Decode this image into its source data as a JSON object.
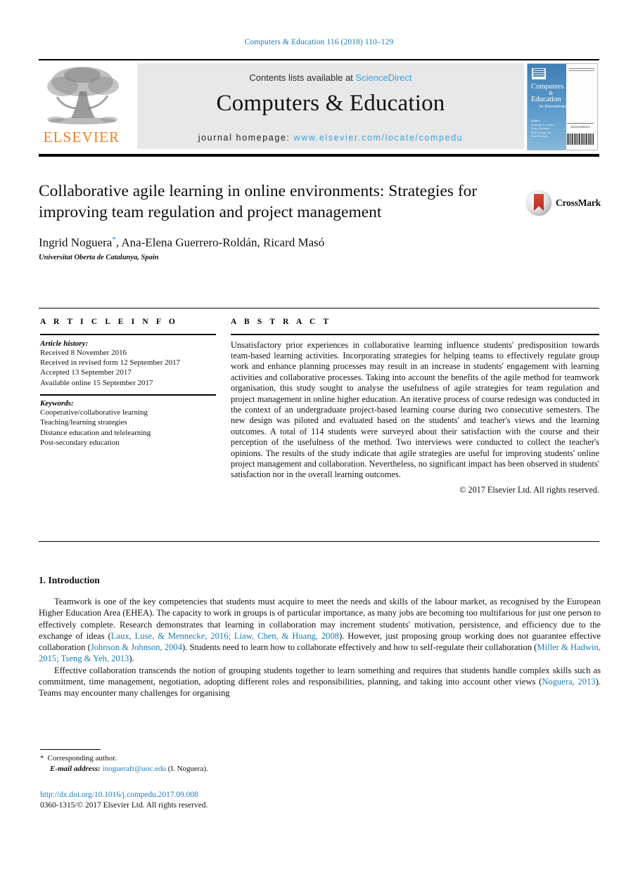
{
  "running_head": "Computers & Education 116 (2018) 110–129",
  "masthead": {
    "contents_prefix": "Contents lists available at ",
    "contents_link": "ScienceDirect",
    "journal_title": "Computers & Education",
    "homepage_prefix": "journal homepage: ",
    "homepage_url": "www.elsevier.com/locate/compedu",
    "publisher_name": "ELSEVIER",
    "publisher_logo": "elsevier-tree-logo"
  },
  "cover": {
    "title_line1": "Computers",
    "amp": "&",
    "title_line2": "Education",
    "subtitle": "An International Journal",
    "editors_label": "Editors",
    "editors": [
      "Rachelle S. Heller",
      "Peter Reimann",
      "Mike Chung Tai",
      "Kent Norman"
    ],
    "publisher_mark": "ScienceDirect",
    "barcode": "barcode"
  },
  "article": {
    "title": "Collaborative agile learning in online environments: Strategies for improving team regulation and project management",
    "authors": "Ingrid Noguera",
    "author_marker": "*",
    "authors_rest": ", Ana-Elena Guerrero-Roldán, Ricard Masó",
    "affiliation": "Universitat Oberta de Catalunya, Spain",
    "crossmark_label": "CrossMark"
  },
  "info": {
    "heading": "A R T I C L E   I N F O",
    "history_label": "Article history:",
    "history": [
      "Received 8 November 2016",
      "Received in revised form 12 September 2017",
      "Accepted 13 September 2017",
      "Available online 15 September 2017"
    ],
    "keywords_label": "Keywords:",
    "keywords": [
      "Cooperative/collaborative learning",
      "Teaching/learning strategies",
      "Distance education and telelearning",
      "Post-secondary education"
    ]
  },
  "abstract": {
    "heading": "A B S T R A C T",
    "text": "Unsatisfactory prior experiences in collaborative learning influence students' predisposition towards team-based learning activities. Incorporating strategies for helping teams to effectively regulate group work and enhance planning processes may result in an increase in students' engagement with learning activities and collaborative processes. Taking into account the benefits of the agile method for teamwork organisation, this study sought to analyse the usefulness of agile strategies for team regulation and project management in online higher education. An iterative process of course redesign was conducted in the context of an undergraduate project-based learning course during two consecutive semesters. The new design was piloted and evaluated based on the students' and teacher's views and the learning outcomes. A total of 114 students were surveyed about their satisfaction with the course and their perception of the usefulness of the method. Two interviews were conducted to collect the teacher's opinions. The results of the study indicate that agile strategies are useful for improving students' online project management and collaboration. Nevertheless, no significant impact has been observed in students' satisfaction nor in the overall learning outcomes.",
    "copyright": "© 2017 Elsevier Ltd. All rights reserved."
  },
  "section": {
    "number_title": "1. Introduction",
    "paragraph1_a": "Teamwork is one of the key competencies that students must acquire to meet the needs and skills of the labour market, as recognised by the European Higher Education Area (EHEA). The capacity to work in groups is of particular importance, as many jobs are becoming too multifarious for just one person to effectively complete. Research demonstrates that learning in collaboration may increment students' motivation, persistence, and efficiency due to the exchange of ideas (",
    "paragraph1_ref1": "Laux, Luse, & Mennecke, 2016; Liaw, Chen, & Huang, 2008",
    "paragraph1_b": "). However, just proposing group working does not guarantee effective collaboration (",
    "paragraph1_ref2": "Johnson & Johnson, 2004",
    "paragraph1_c": "). Students need to learn how to collaborate effectively and how to self-regulate their collaboration (",
    "paragraph1_ref3": "Miller & Hadwin, 2015; Tseng & Yeh, 2013",
    "paragraph1_d": ").",
    "paragraph2_a": "Effective collaboration transcends the notion of grouping students together to learn something and requires that students handle complex skills such as commitment, time management, negotiation, adopting different roles and responsibilities, planning, and taking into account other views (",
    "paragraph2_ref1": "Noguera, 2013",
    "paragraph2_b": "). Teams may encounter many challenges for organising"
  },
  "footer": {
    "corresponding_marker": "*",
    "corresponding_label": "Corresponding author.",
    "email_label": "E-mail address:",
    "email": "inoguerafr@uoc.edu",
    "email_owner": "(I. Noguera).",
    "doi_url": "http://dx.doi.org/10.1016/j.compedu.2017.09.008",
    "issn_line": "0360-1315/© 2017 Elsevier Ltd. All rights reserved."
  },
  "colors": {
    "link_blue": "#1a7bb9",
    "light_blue": "#3d9fd4",
    "elsevier_orange": "#f07f20",
    "band_gray": "#e8e8e8"
  }
}
